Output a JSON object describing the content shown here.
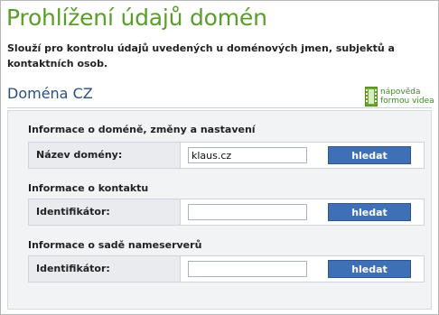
{
  "page": {
    "title": "Prohlížení údajů domén",
    "intro": "Slouží pro kontrolu údajů uvedených u doménových jmen, subjektů a kontaktních osob."
  },
  "section": {
    "title": "Doména CZ",
    "help_line1": "nápověda",
    "help_line2": "formou videa"
  },
  "domain_group": {
    "title": "Informace o doméně, změny a nastavení",
    "field_label": "Název domény:",
    "field_value": "klaus.cz",
    "button_label": "hledat"
  },
  "contact_group": {
    "title": "Informace o kontaktu",
    "field_label": "Identifikátor:",
    "field_value": "",
    "button_label": "hledat"
  },
  "nsset_group": {
    "title": "Informace o sadě nameserverů",
    "field_label": "Identifikátor:",
    "field_value": "",
    "button_label": "hledat"
  },
  "colors": {
    "title_green": "#5a9e2a",
    "section_blue": "#2a4f86",
    "button_blue": "#3f6fb5",
    "label_cell_gray": "#e9ebee"
  },
  "icons": {
    "help": "film-strip-icon"
  }
}
